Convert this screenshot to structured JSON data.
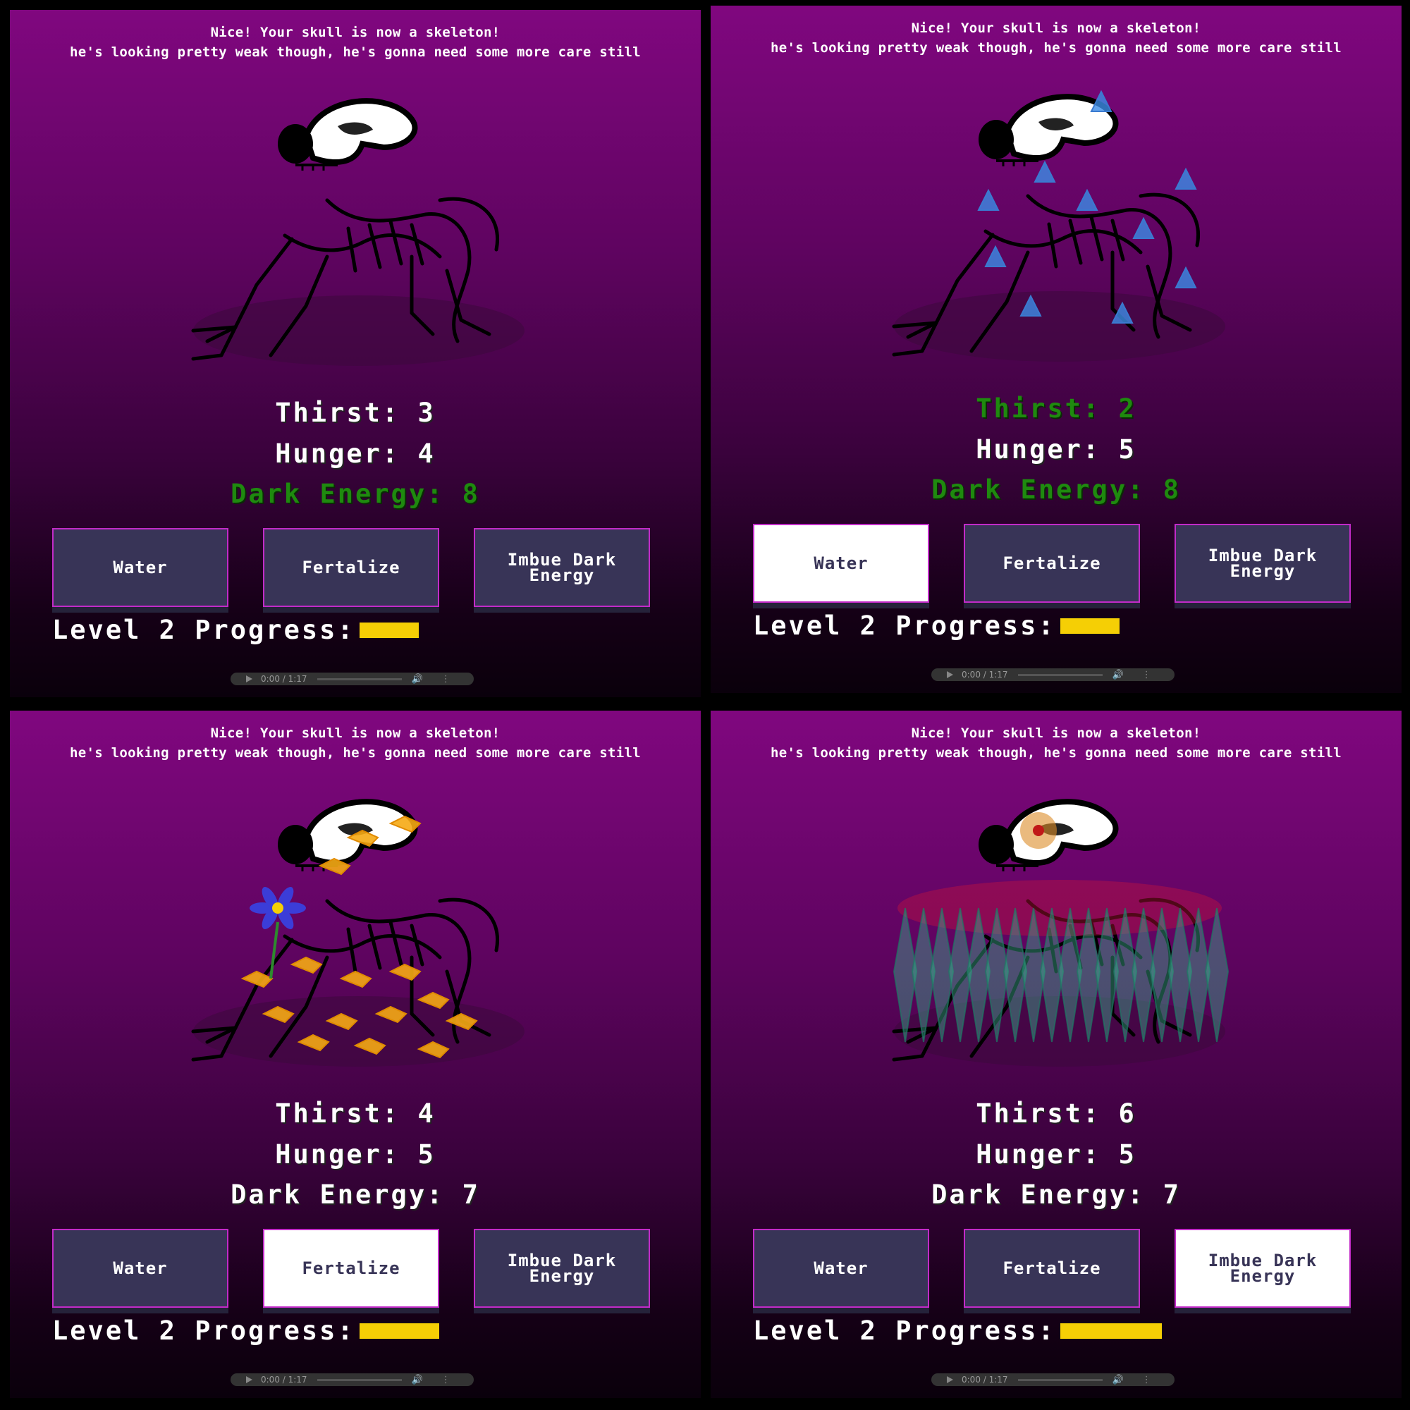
{
  "message": {
    "line1": "Nice! Your skull is now a skeleton!",
    "line2": "he's looking pretty weak though, he's gonna need some more care still"
  },
  "labels": {
    "thirst": "Thirst:",
    "hunger": "Hunger:",
    "energy": "Dark Energy:",
    "progress": "Level 2 Progress:"
  },
  "buttons": {
    "water": "Water",
    "fertalize": "Fertalize",
    "imbue_line1": "Imbue Dark",
    "imbue_line2": "Energy"
  },
  "audio": {
    "time": "0:00 / 1:17",
    "play_icon": "play-icon",
    "volume_icon": "volume-icon",
    "more_icon": "more-vertical-icon"
  },
  "colors": {
    "progress": "#f5cf05",
    "highlight_green": "#1f8a0f",
    "button_bg": "#383457",
    "button_border": "#c22bc8"
  },
  "panels": [
    {
      "thirst": "3",
      "hunger": "4",
      "energy": "8",
      "progress_fraction": 0.35,
      "active_button": "none",
      "green_stats": [
        "energy"
      ],
      "effect": "none"
    },
    {
      "thirst": "2",
      "hunger": "5",
      "energy": "8",
      "progress_fraction": 0.35,
      "active_button": "water",
      "green_stats": [
        "thirst",
        "energy"
      ],
      "effect": "water-drops"
    },
    {
      "thirst": "4",
      "hunger": "5",
      "energy": "7",
      "progress_fraction": 0.47,
      "active_button": "fertalize",
      "green_stats": [],
      "effect": "fertilizer-flower"
    },
    {
      "thirst": "6",
      "hunger": "5",
      "energy": "7",
      "progress_fraction": 0.6,
      "active_button": "imbue",
      "green_stats": [],
      "effect": "dark-crystals"
    }
  ]
}
